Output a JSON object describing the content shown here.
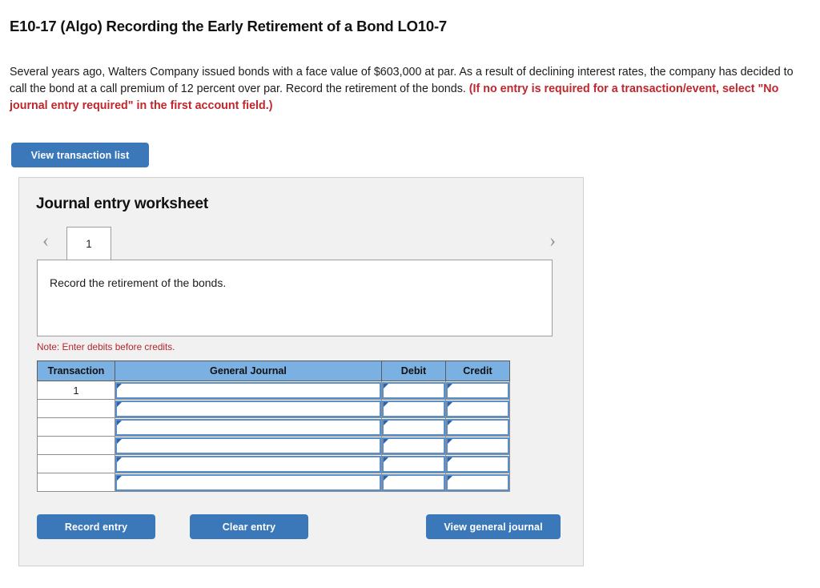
{
  "question": {
    "title": "E10-17 (Algo) Recording the Early Retirement of a Bond LO10-7",
    "body_part1": "Several years ago, Walters Company issued bonds with a face value of $603,000 at par. As a result of declining interest rates, the company has decided to call the bond at a call premium of 12 percent over par. Record the retirement of the bonds. ",
    "body_highlight": "(If no entry is required for a transaction/event, select \"No journal entry required\" in the first account field.)"
  },
  "toolbar": {
    "view_transaction_list_label": "View transaction list"
  },
  "worksheet": {
    "title": "Journal entry worksheet",
    "pager": {
      "prev_icon": "chevron-left-icon",
      "next_icon": "chevron-right-icon",
      "tabs": [
        "1"
      ],
      "active_tab": "1"
    },
    "description": "Record the retirement of the bonds.",
    "note": "Note: Enter debits before credits.",
    "table": {
      "headers": [
        "Transaction",
        "General Journal",
        "Debit",
        "Credit"
      ],
      "rows": [
        {
          "transaction": "1",
          "general_journal": "",
          "debit": "",
          "credit": ""
        },
        {
          "transaction": "",
          "general_journal": "",
          "debit": "",
          "credit": ""
        },
        {
          "transaction": "",
          "general_journal": "",
          "debit": "",
          "credit": ""
        },
        {
          "transaction": "",
          "general_journal": "",
          "debit": "",
          "credit": ""
        },
        {
          "transaction": "",
          "general_journal": "",
          "debit": "",
          "credit": ""
        },
        {
          "transaction": "",
          "general_journal": "",
          "debit": "",
          "credit": ""
        }
      ]
    },
    "buttons": {
      "record_entry": "Record entry",
      "clear_entry": "Clear entry",
      "view_general_journal": "View general journal"
    }
  },
  "colors": {
    "button_blue": "#3a78b9",
    "table_header_blue": "#7bb0e3",
    "note_red": "#b5262c",
    "highlight_red": "#c0262c",
    "panel_gray": "#f1f1f1"
  }
}
